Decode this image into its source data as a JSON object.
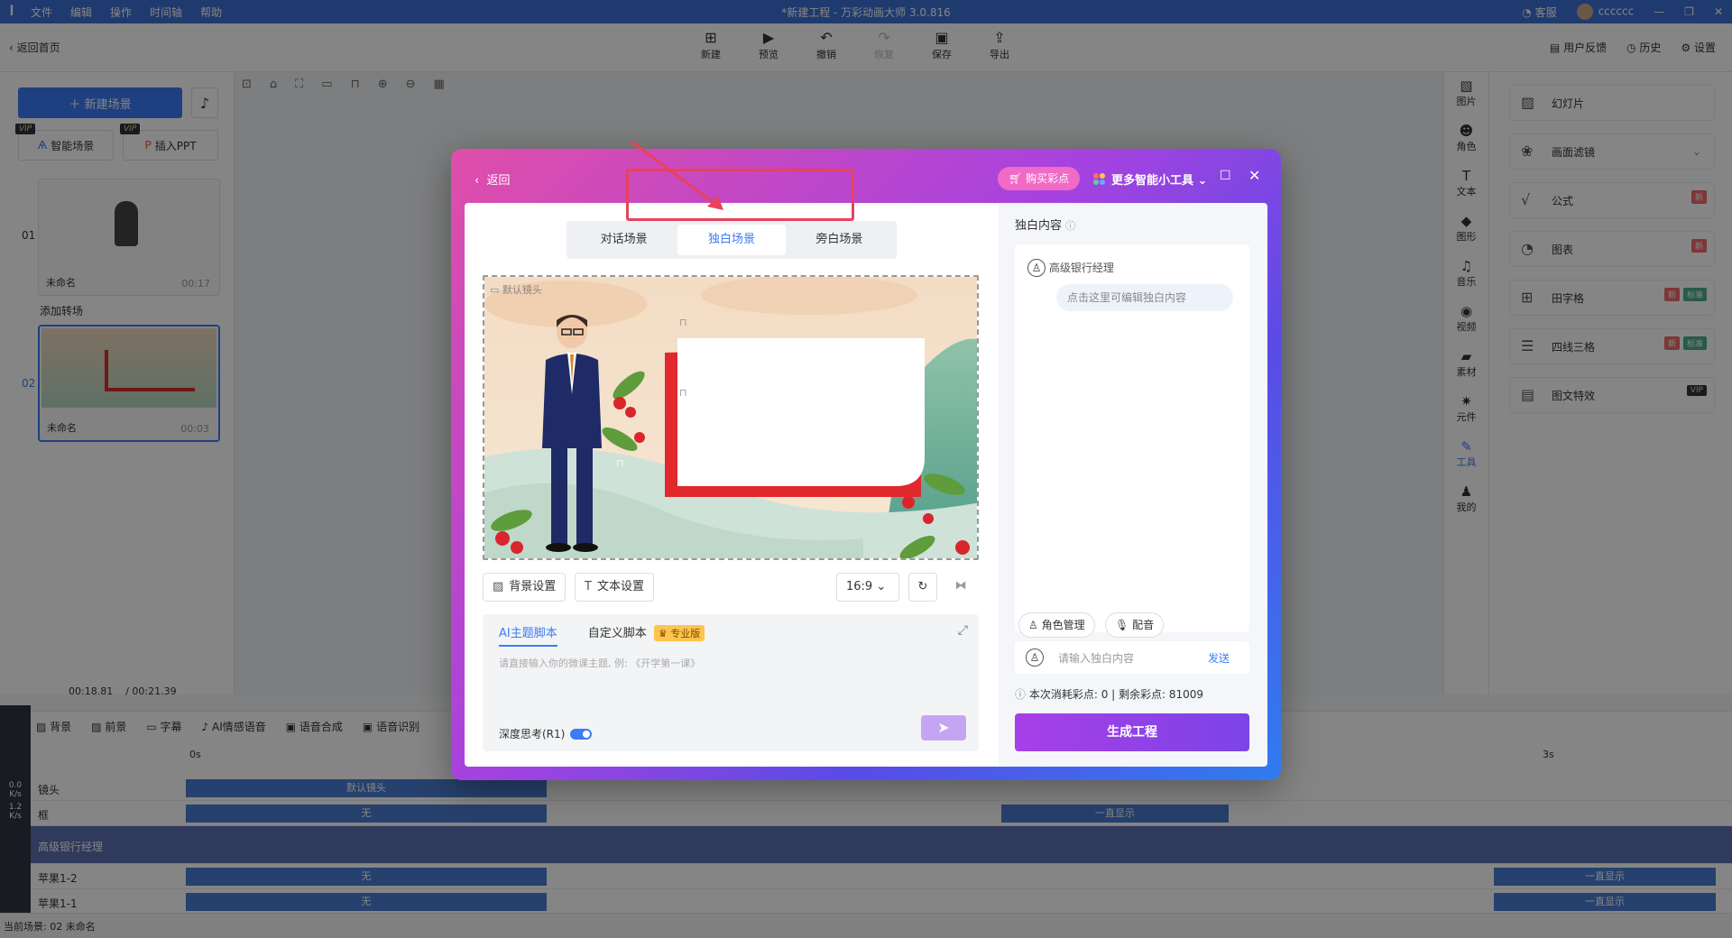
{
  "titlebar": {
    "title": "*新建工程 - 万彩动画大师 3.0.816",
    "menu": [
      "文件",
      "编辑",
      "操作",
      "时间轴",
      "帮助"
    ],
    "service": "客服",
    "username": "cccccc"
  },
  "toolbar": {
    "back_label": "返回首页",
    "buttons": [
      "新建",
      "预览",
      "撤销",
      "恢复",
      "保存",
      "导出"
    ],
    "right": [
      "用户反馈",
      "历史",
      "设置"
    ]
  },
  "left_panel": {
    "new_scene": "新建场景",
    "smart_scene": "智能场景",
    "insert_ppt": "插入PPT",
    "vip": "VIP",
    "scenes": [
      {
        "num": "01",
        "name": "未命名",
        "duration": "00:17"
      },
      {
        "num": "02",
        "name": "未命名",
        "duration": "00:03"
      }
    ],
    "add_transition": "添加转场"
  },
  "right_icons": [
    "图片",
    "角色",
    "文本",
    "图形",
    "音乐",
    "视频",
    "素材",
    "元件",
    "工具",
    "我的"
  ],
  "right_panel": {
    "items": [
      "幻灯片",
      "画面滤镜",
      "公式",
      "图表",
      "田字格",
      "四线三格",
      "图文特效"
    ],
    "badge_new": "新",
    "badge_std": "标准",
    "badge_vip": "VIP"
  },
  "timeline": {
    "time_current": "00:18.81",
    "time_total": "/ 00:21.39",
    "tools": [
      "背景",
      "前景",
      "字幕",
      "AI情感语音",
      "语音合成",
      "语音识别"
    ],
    "ruler_0": "0s",
    "ruler_3": "3s",
    "tracks": [
      {
        "label": "镜头",
        "seg": "默认镜头"
      },
      {
        "label": "框",
        "seg": "无",
        "seg2": "一直显示"
      },
      {
        "label": "高级银行经理",
        "seg": ""
      },
      {
        "label": "苹果1-2",
        "seg": "无",
        "seg2": "一直显示"
      },
      {
        "label": "苹果1-1",
        "seg": "无",
        "seg2": "一直显示"
      }
    ],
    "speed1": "0.0",
    "speed2": "1.2",
    "unit": "K/s"
  },
  "statusbar": {
    "text": "当前场景: 02   未命名"
  },
  "modal": {
    "back": "返回",
    "buy": "购买彩点",
    "more_tools": "更多智能小工具",
    "tabs": [
      {
        "label": "对话场景",
        "active": false
      },
      {
        "label": "独白场景",
        "active": true
      },
      {
        "label": "旁白场景",
        "active": false
      }
    ],
    "preview_label": "默认镜头",
    "bg_settings": "背景设置",
    "text_settings": "文本设置",
    "ratio": "16:9",
    "script_tabs": [
      "AI主题脚本",
      "自定义脚本"
    ],
    "pro_tag": "专业版",
    "script_placeholder": "请直接输入你的微课主题, 例: 《开学第一课》",
    "deep_think": "深度思考(R1)",
    "right": {
      "title": "独白内容",
      "speaker": "高级银行经理",
      "bubble": "点击这里可编辑独白内容",
      "role_mgmt": "角色管理",
      "dubbing": "配音",
      "input_placeholder": "请输入独白内容",
      "send": "发送",
      "cost": "本次消耗彩点: 0 | 剩余彩点: 81009",
      "generate": "生成工程"
    }
  },
  "colors": {
    "accent": "#3b7cf5",
    "highlight_box": "#e8425c",
    "generate_btn": "#9b40e8"
  }
}
